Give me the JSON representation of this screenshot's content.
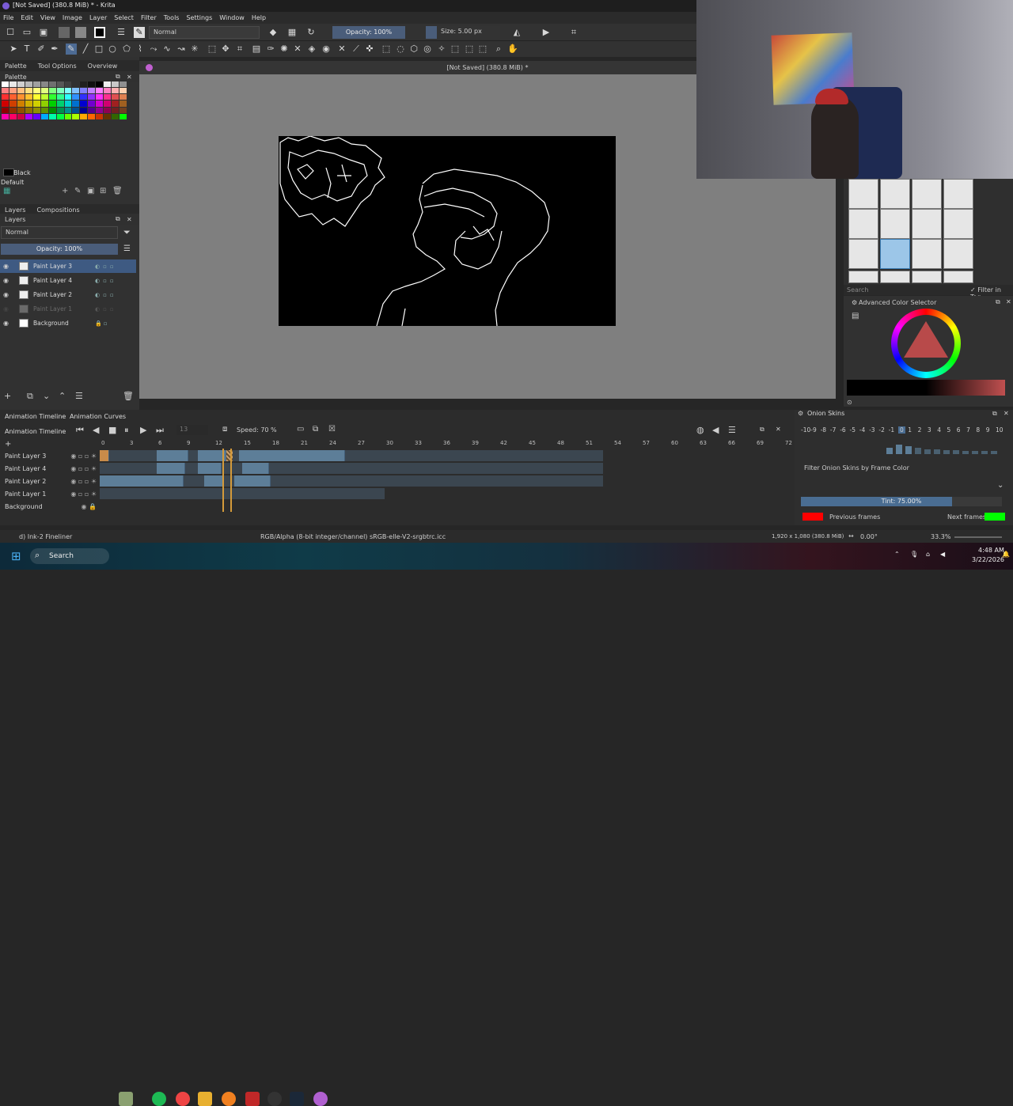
{
  "window": {
    "title": "[Not Saved]  (380.8 MiB) * - Krita"
  },
  "menu": [
    "File",
    "Edit",
    "View",
    "Image",
    "Layer",
    "Select",
    "Filter",
    "Tools",
    "Settings",
    "Window",
    "Help"
  ],
  "toolbar": {
    "blend_mode": "Normal",
    "opacity_label": "Opacity: 100%",
    "size_label": "Size: 5.00 px"
  },
  "left_dock": {
    "tabs": [
      "Palette",
      "Tool Options",
      "Overview"
    ],
    "palette_title": "Palette",
    "current_color_name": "Black",
    "palette_name": "Default",
    "layers_tabs": [
      "Layers",
      "Compositions"
    ],
    "layers_title": "Layers",
    "layer_blend": "Normal",
    "layer_opacity": "Opacity:  100%",
    "layers": [
      {
        "name": "Paint Layer 3",
        "selected": true,
        "visible": true
      },
      {
        "name": "Paint Layer 4",
        "selected": false,
        "visible": true
      },
      {
        "name": "Paint Layer 2",
        "selected": false,
        "visible": true
      },
      {
        "name": "Paint Layer 1",
        "selected": false,
        "visible": false
      },
      {
        "name": "Background",
        "selected": false,
        "visible": true
      }
    ],
    "palette_colors": [
      "#ffffff",
      "#e8e8e8",
      "#d0d0d0",
      "#b8b8b8",
      "#a0a0a0",
      "#888888",
      "#707070",
      "#585858",
      "#404040",
      "#303030",
      "#202020",
      "#101010",
      "#000000",
      "#f0f0f0",
      "#c8c8c8",
      "#909090",
      "#ff8080",
      "#ffa080",
      "#ffc080",
      "#ffe080",
      "#ffff80",
      "#e0ff80",
      "#80ff80",
      "#80ffc0",
      "#80ffff",
      "#80c0ff",
      "#8080ff",
      "#c080ff",
      "#ff80ff",
      "#ff80c0",
      "#ffb0b0",
      "#ffd0b0",
      "#ff3030",
      "#ff6030",
      "#ff9030",
      "#ffc030",
      "#ffff30",
      "#c0ff30",
      "#30ff30",
      "#30ff90",
      "#30ffff",
      "#3090ff",
      "#3030ff",
      "#9030ff",
      "#ff30ff",
      "#ff3090",
      "#e05050",
      "#e08050",
      "#d00000",
      "#d04000",
      "#d08000",
      "#d0b000",
      "#d0d000",
      "#90d000",
      "#00d000",
      "#00d070",
      "#00d0d0",
      "#0070d0",
      "#0000d0",
      "#7000d0",
      "#d000d0",
      "#d00070",
      "#a02020",
      "#a06020",
      "#900000",
      "#903000",
      "#905000",
      "#907000",
      "#909000",
      "#609000",
      "#009000",
      "#009050",
      "#009090",
      "#005090",
      "#000090",
      "#500090",
      "#900090",
      "#900050",
      "#702020",
      "#704020",
      "#ff00aa",
      "#ff0066",
      "#cc0044",
      "#aa00ff",
      "#6600ff",
      "#00aaff",
      "#00ffaa",
      "#00ff44",
      "#66ff00",
      "#aaff00",
      "#ffaa00",
      "#ff6600",
      "#cc3300",
      "#663300",
      "#336600",
      "#00ff00"
    ]
  },
  "canvas": {
    "title": "[Not Saved]  (380.8 MiB) *"
  },
  "right_dock": {
    "search_placeholder": "Search",
    "filter_in_tag": "Filter in Tag",
    "color_selector_title": "Advanced Color Selector"
  },
  "timeline": {
    "tabs": [
      "Animation Timeline",
      "Animation Curves"
    ],
    "title": "Animation Timeline",
    "current_frame": "13",
    "speed_label": "Speed: 70 %",
    "frame_numbers": [
      "0",
      "3",
      "6",
      "9",
      "12",
      "15",
      "18",
      "21",
      "24",
      "27",
      "30",
      "33",
      "36",
      "39",
      "42",
      "45",
      "48",
      "51",
      "54",
      "57",
      "60",
      "63",
      "66",
      "69",
      "72"
    ],
    "rows": [
      "Paint Layer 3",
      "Paint Layer 4",
      "Paint Layer 2",
      "Paint Layer 1",
      "Background"
    ]
  },
  "onion": {
    "title": "Onion Skins",
    "numbers": [
      "-10",
      "-9",
      "-8",
      "-7",
      "-6",
      "-5",
      "-4",
      "-3",
      "-2",
      "-1",
      "0",
      "1",
      "2",
      "3",
      "4",
      "5",
      "6",
      "7",
      "8",
      "9",
      "10"
    ],
    "filter_label": "Filter Onion Skins by Frame Color",
    "tint_label": "Tint: 75.00%",
    "tint_fraction": 0.75,
    "previous_label": "Previous frames",
    "next_label": "Next frames",
    "previous_color": "#ff0000",
    "next_color": "#00ff00"
  },
  "status": {
    "brush": "d) Ink-2 Fineliner",
    "color_profile": "RGB/Alpha (8-bit integer/channel)  sRGB-elle-V2-srgbtrc.icc",
    "image_size": "1,920 x 1,080 (380.8 MiB)",
    "rotation": "0.00°",
    "zoom": "33.3%"
  },
  "taskbar": {
    "search_label": "Search",
    "time": "4:48 AM",
    "date": "3/22/2026"
  }
}
